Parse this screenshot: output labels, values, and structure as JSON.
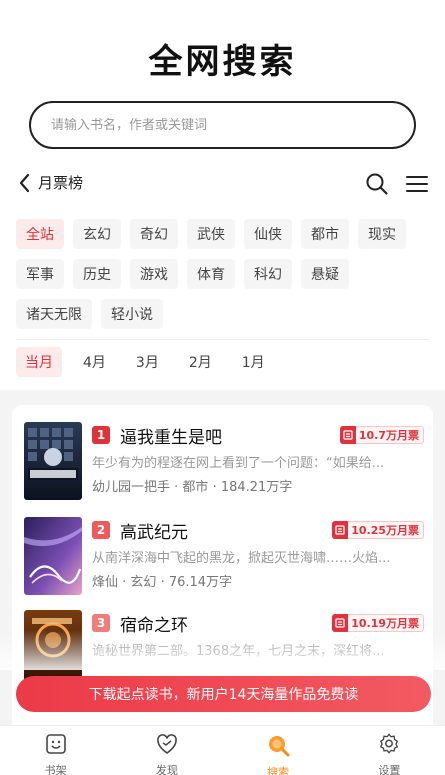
{
  "app_title": "全网搜索",
  "search": {
    "placeholder": "请输入书名，作者或关键词"
  },
  "nav": {
    "back_label": "月票榜"
  },
  "categories": [
    "全站",
    "玄幻",
    "奇幻",
    "武侠",
    "仙侠",
    "都市",
    "现实",
    "军事",
    "历史",
    "游戏",
    "体育",
    "科幻",
    "悬疑",
    "诸天无限",
    "轻小说"
  ],
  "active_category": "全站",
  "months": [
    "当月",
    "4月",
    "3月",
    "2月",
    "1月"
  ],
  "active_month": "当月",
  "books": [
    {
      "rank": "1",
      "title": "逼我重生是吧",
      "tickets": "10.7万月票",
      "desc": "年少有为的程逐在网上看到了一个问题：“如果给...",
      "author": "幼儿园一把手",
      "genre": "都市",
      "words": "184.21万字",
      "cover_text": "逼我重生",
      "rank_color": "#e0323c"
    },
    {
      "rank": "2",
      "title": "高武纪元",
      "tickets": "10.25万月票",
      "desc": "从南洋深海中飞起的黑龙，掀起灭世海啸……火焰...",
      "author": "烽仙",
      "genre": "玄幻",
      "words": "76.14万字",
      "cover_text": "高武纪元",
      "rank_color": "#ee5a5a"
    },
    {
      "rank": "3",
      "title": "宿命之环",
      "tickets": "10.19万月票",
      "desc": "诡秘世界第二部。1368之年，七月之末，深红将...",
      "author": "",
      "genre": "",
      "words": "",
      "cover_text": "宿命之环",
      "rank_color": "#f07c7c"
    }
  ],
  "download_banner": "下载起点读书，新用户14天海量作品免费读",
  "tabs": [
    {
      "label": "书架",
      "icon": "bookshelf-icon"
    },
    {
      "label": "发现",
      "icon": "discover-icon"
    },
    {
      "label": "搜索",
      "icon": "search-icon"
    },
    {
      "label": "设置",
      "icon": "settings-icon"
    }
  ],
  "active_tab": "搜索",
  "colors": {
    "accent": "#e0323c",
    "tab_active": "#ff8a1c"
  }
}
